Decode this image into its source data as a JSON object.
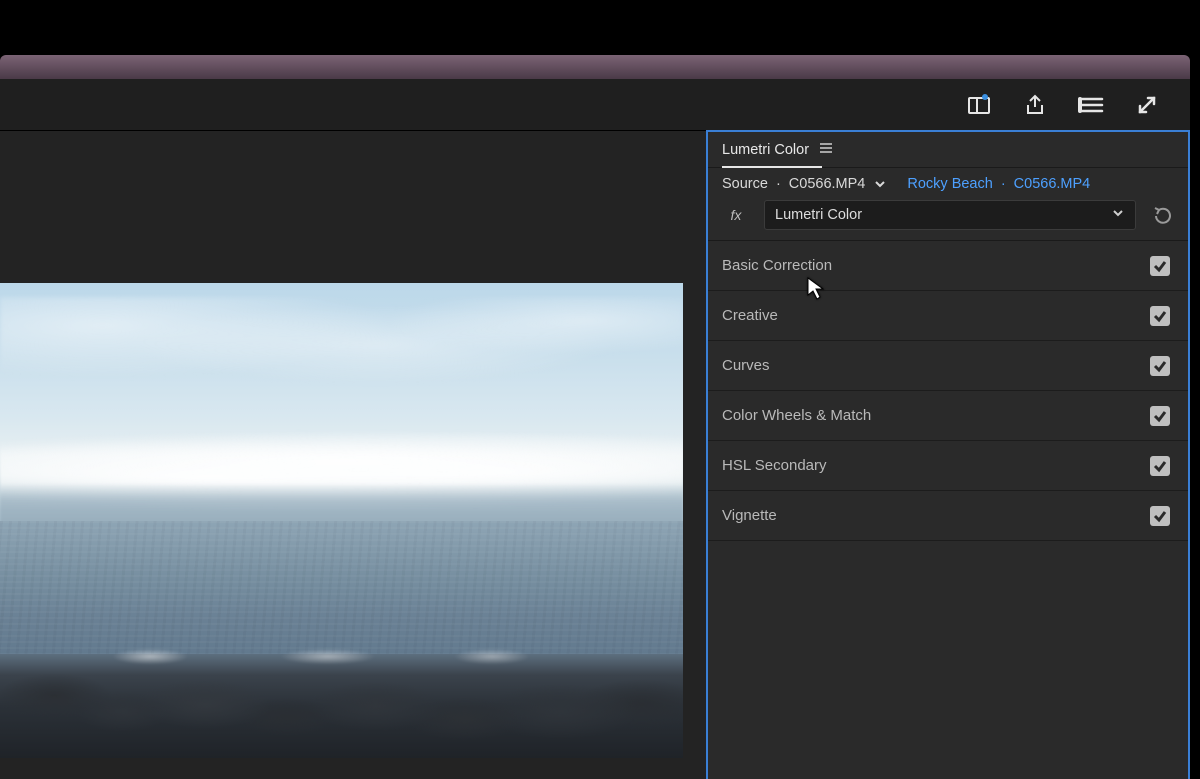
{
  "panel": {
    "title": "Lumetri Color",
    "source_prefix": "Source",
    "dot": "·",
    "source_clip": "C0566.MP4",
    "sequence": "Rocky Beach",
    "sequence_clip": "C0566.MP4",
    "fx_label": "fx",
    "effect_name": "Lumetri Color"
  },
  "sections": [
    {
      "label": "Basic Correction",
      "checked": true
    },
    {
      "label": "Creative",
      "checked": true
    },
    {
      "label": "Curves",
      "checked": true
    },
    {
      "label": "Color Wheels & Match",
      "checked": true
    },
    {
      "label": "HSL Secondary",
      "checked": true
    },
    {
      "label": "Vignette",
      "checked": true
    }
  ],
  "toolbar_icons": [
    "workspace-icon",
    "export-icon",
    "quick-export-icon",
    "fullscreen-icon"
  ]
}
